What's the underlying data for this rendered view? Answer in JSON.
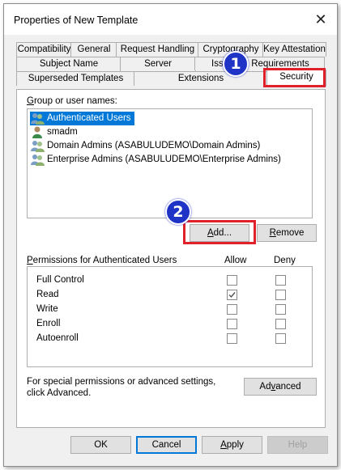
{
  "window": {
    "title": "Properties of New Template",
    "close": "✕"
  },
  "tabs": {
    "row1": [
      "Compatibility",
      "General",
      "Request Handling",
      "Cryptography",
      "Key Attestation"
    ],
    "row2": [
      "Subject Name",
      "Server",
      "Issuance Requirements"
    ],
    "row3": [
      "Superseded Templates",
      "Extensions",
      "Security"
    ],
    "active": "Security"
  },
  "annotations": {
    "step1": "1",
    "step2": "2"
  },
  "security": {
    "group_label": "Group or user names:",
    "users": [
      {
        "name": "Authenticated Users",
        "icon": "group-users-icon",
        "selected": true
      },
      {
        "name": "smadm",
        "icon": "single-user-icon",
        "selected": false
      },
      {
        "name": "Domain Admins (ASABULUDEMO\\Domain Admins)",
        "icon": "group-users-icon",
        "selected": false
      },
      {
        "name": "Enterprise Admins (ASABULUDEMO\\Enterprise Admins)",
        "icon": "group-users-icon",
        "selected": false
      }
    ],
    "add_button": "Add...",
    "remove_button": "Remove",
    "permissions_label": "Permissions for Authenticated Users",
    "allow_header": "Allow",
    "deny_header": "Deny",
    "permissions": [
      {
        "name": "Full Control",
        "allow": false,
        "deny": false
      },
      {
        "name": "Read",
        "allow": true,
        "deny": false
      },
      {
        "name": "Write",
        "allow": false,
        "deny": false
      },
      {
        "name": "Enroll",
        "allow": false,
        "deny": false
      },
      {
        "name": "Autoenroll",
        "allow": false,
        "deny": false
      }
    ],
    "special_text": "For special permissions or advanced settings, click Advanced.",
    "advanced_button": "Advanced"
  },
  "footer": {
    "ok": "OK",
    "cancel": "Cancel",
    "apply": "Apply",
    "help": "Help"
  },
  "colors": {
    "selection": "#0078d7",
    "annotation_red": "#e0202a",
    "badge_blue": "#1f33c7"
  }
}
